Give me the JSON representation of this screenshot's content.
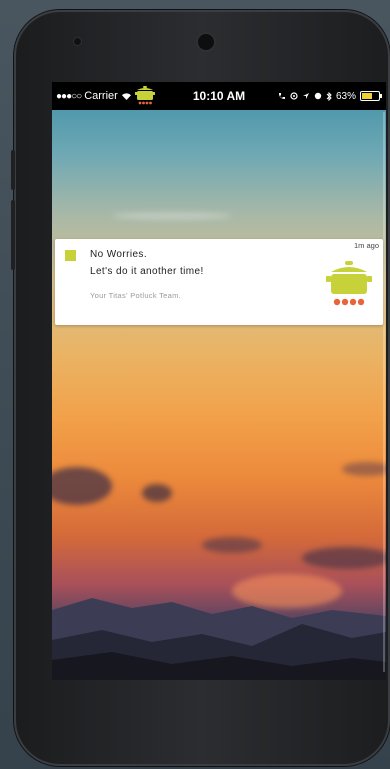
{
  "status_bar": {
    "signal_dots": "●●●○○",
    "carrier": "Carrier",
    "time": "10:10 AM",
    "battery_text": "63%",
    "battery_level": 0.63
  },
  "notification": {
    "title": "No Worries.",
    "body": "Let's do it another time!",
    "signature": "Your Titas' Potluck Team.",
    "timestamp": "1m ago"
  },
  "colors": {
    "accent_green": "#c7d23b",
    "burner_orange": "#e8643c",
    "battery_yellow": "#f1d233"
  }
}
